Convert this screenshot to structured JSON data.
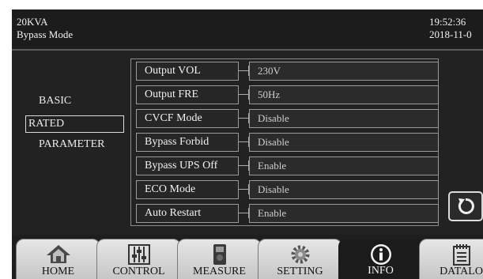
{
  "header": {
    "model": "20KVA",
    "mode": "Bypass Mode",
    "time": "19:52:36",
    "date": "2018-11-0"
  },
  "categories": {
    "basic": "BASIC",
    "rated": "RATED",
    "parameter": "PARAMETER",
    "selected": "RATED"
  },
  "rows": [
    {
      "label": "Output VOL",
      "value": "230V"
    },
    {
      "label": "Output FRE",
      "value": "50Hz"
    },
    {
      "label": "CVCF Mode",
      "value": "Disable"
    },
    {
      "label": "Bypass Forbid",
      "value": "Disable"
    },
    {
      "label": "Bypass UPS Off",
      "value": "Enable"
    },
    {
      "label": "ECO Mode",
      "value": "Disable"
    },
    {
      "label": "Auto Restart",
      "value": "Enable"
    }
  ],
  "back_icon": "refresh-back-icon",
  "tabs": [
    {
      "label": "HOME",
      "icon": "home-icon"
    },
    {
      "label": "CONTROL",
      "icon": "sliders-icon"
    },
    {
      "label": "MEASURE",
      "icon": "meter-icon"
    },
    {
      "label": "SETTING",
      "icon": "gear-icon"
    },
    {
      "label": "INFO",
      "icon": "info-icon"
    },
    {
      "label": "DATALO",
      "icon": "datalog-icon"
    }
  ],
  "active_tab": "INFO"
}
